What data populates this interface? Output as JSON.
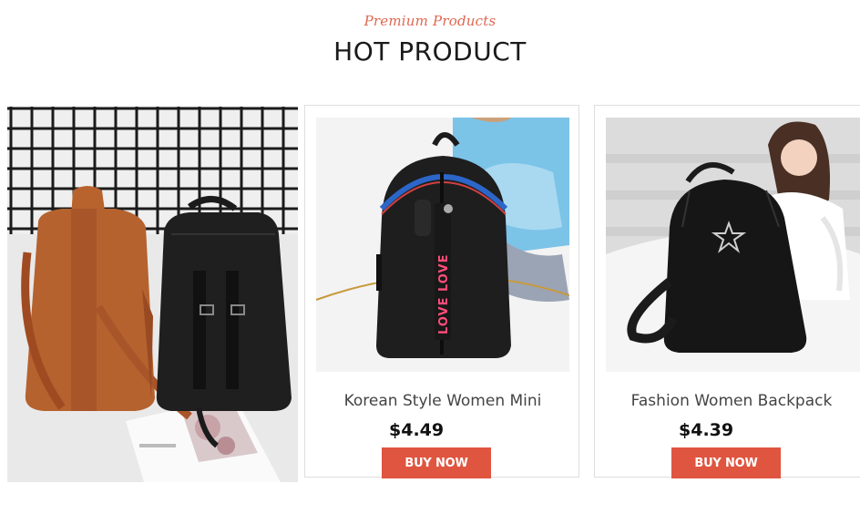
{
  "header": {
    "subtitle": "Premium Products",
    "title": "HOT PRODUCT"
  },
  "products": [
    {
      "name": "Korean Style Women Mini",
      "price": "$4.49",
      "button_label": "BUY NOW",
      "strap_text": "LOVE LOVE"
    },
    {
      "name": "Fashion Women Backpack",
      "price": "$4.39",
      "button_label": "BUY NOW"
    }
  ],
  "colors": {
    "accent": "#df553f",
    "subtitle": "#e0664f",
    "title": "#1a1a1a",
    "price": "#111111"
  }
}
